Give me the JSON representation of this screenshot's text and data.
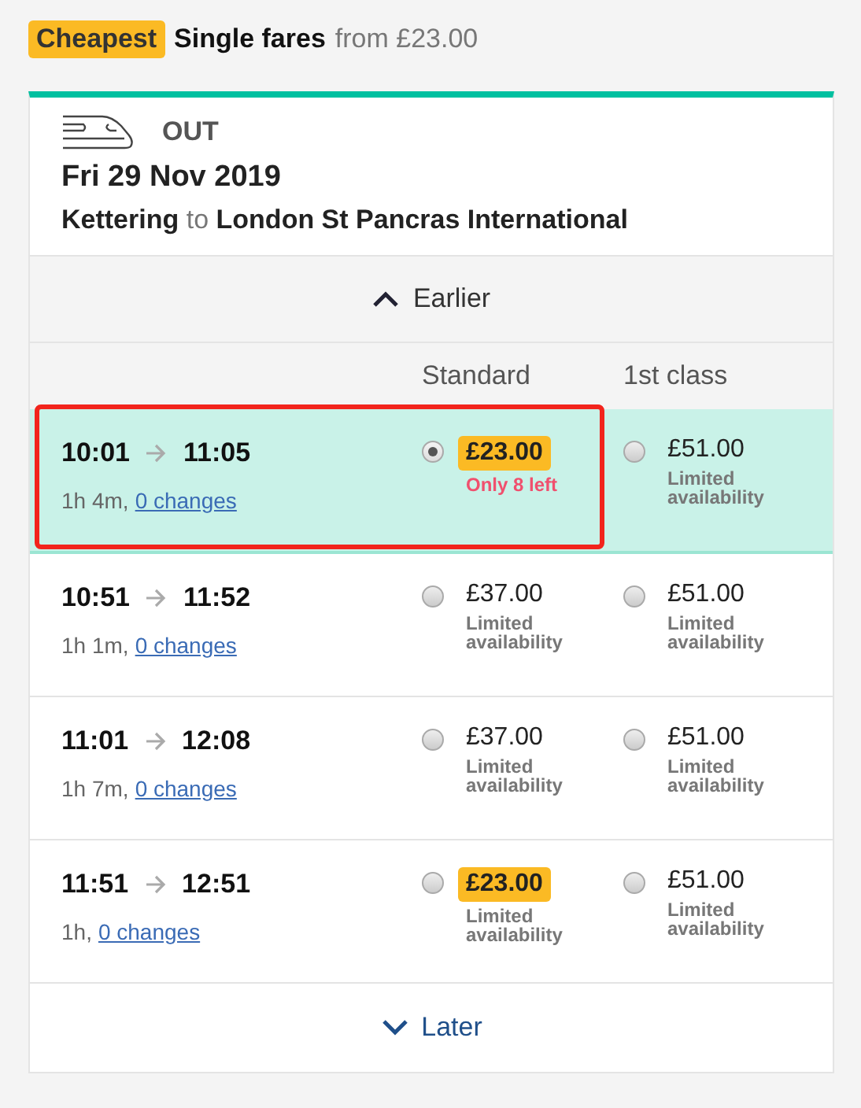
{
  "summary": {
    "badge": "Cheapest",
    "title": "Single fares",
    "from": "from £23.00"
  },
  "journey": {
    "direction": "OUT",
    "date": "Fri 29 Nov 2019",
    "origin": "Kettering",
    "connector": "to",
    "destination": "London St Pancras International"
  },
  "earlier": "Earlier",
  "columns": [
    "Standard",
    "1st class"
  ],
  "rows": [
    {
      "depart": "10:01",
      "arrive": "11:05",
      "duration": "1h 4m,",
      "changes": "0 changes",
      "selected": true,
      "highlighted": true,
      "fares": [
        {
          "price": "£23.00",
          "cheapest": true,
          "selected": true,
          "note": "Only 8 left",
          "urgent": true
        },
        {
          "price": "£51.00",
          "cheapest": false,
          "selected": false,
          "note": "Limited availability",
          "urgent": false
        }
      ]
    },
    {
      "depart": "10:51",
      "arrive": "11:52",
      "duration": "1h 1m,",
      "changes": "0 changes",
      "selected": false,
      "highlighted": false,
      "fares": [
        {
          "price": "£37.00",
          "cheapest": false,
          "selected": false,
          "note": "Limited availability",
          "urgent": false
        },
        {
          "price": "£51.00",
          "cheapest": false,
          "selected": false,
          "note": "Limited availability",
          "urgent": false
        }
      ]
    },
    {
      "depart": "11:01",
      "arrive": "12:08",
      "duration": "1h 7m,",
      "changes": "0 changes",
      "selected": false,
      "highlighted": false,
      "fares": [
        {
          "price": "£37.00",
          "cheapest": false,
          "selected": false,
          "note": "Limited availability",
          "urgent": false
        },
        {
          "price": "£51.00",
          "cheapest": false,
          "selected": false,
          "note": "Limited availability",
          "urgent": false
        }
      ]
    },
    {
      "depart": "11:51",
      "arrive": "12:51",
      "duration": "1h,",
      "changes": "0 changes",
      "selected": false,
      "highlighted": false,
      "fares": [
        {
          "price": "£23.00",
          "cheapest": true,
          "selected": false,
          "note": "Limited availability",
          "urgent": false
        },
        {
          "price": "£51.00",
          "cheapest": false,
          "selected": false,
          "note": "Limited availability",
          "urgent": false
        }
      ]
    }
  ],
  "later": "Later"
}
